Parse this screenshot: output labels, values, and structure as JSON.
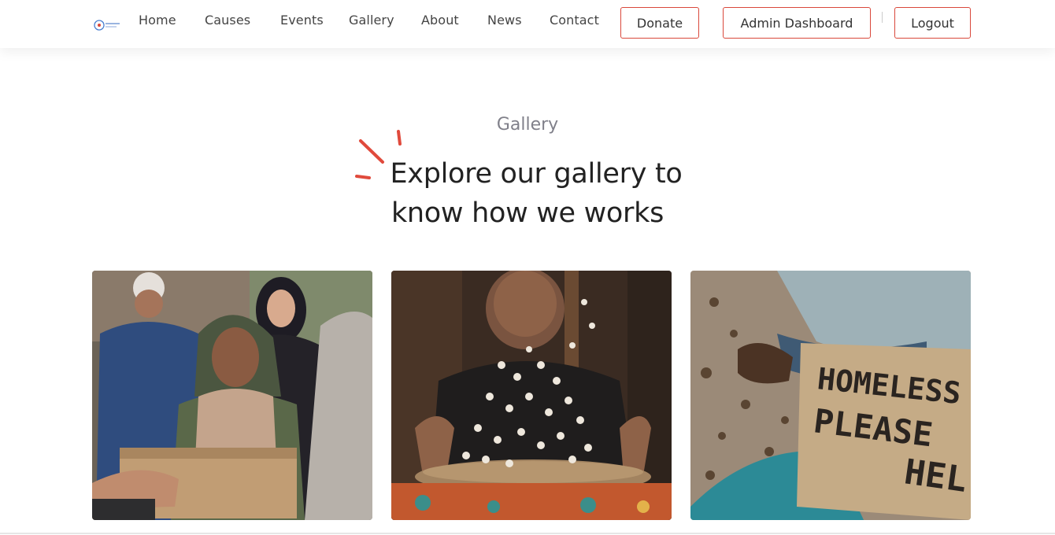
{
  "nav": {
    "links": [
      "Home",
      "Causes",
      "Events",
      "Gallery",
      "About",
      "News",
      "Contact"
    ],
    "donate_label": "Donate",
    "admin_label": "Admin Dashboard",
    "logout_label": "Logout"
  },
  "section": {
    "eyebrow": "Gallery",
    "title_part1": "Explore our ",
    "title_highlight": "gallery",
    "title_part2": " to",
    "title_line2": "know how we works"
  },
  "gallery": {
    "items": [
      {
        "icon": "charity-box-photo"
      },
      {
        "icon": "woman-cotton-photo"
      },
      {
        "icon": "homeless-sign-photo"
      }
    ],
    "sign_text_1": "HOMELESS",
    "sign_text_2": "PLEASE",
    "sign_text_3": "HEL"
  },
  "colors": {
    "accent": "#d9483b",
    "highlight": "#f7c52e",
    "text": "#222222",
    "muted": "#80808a"
  }
}
